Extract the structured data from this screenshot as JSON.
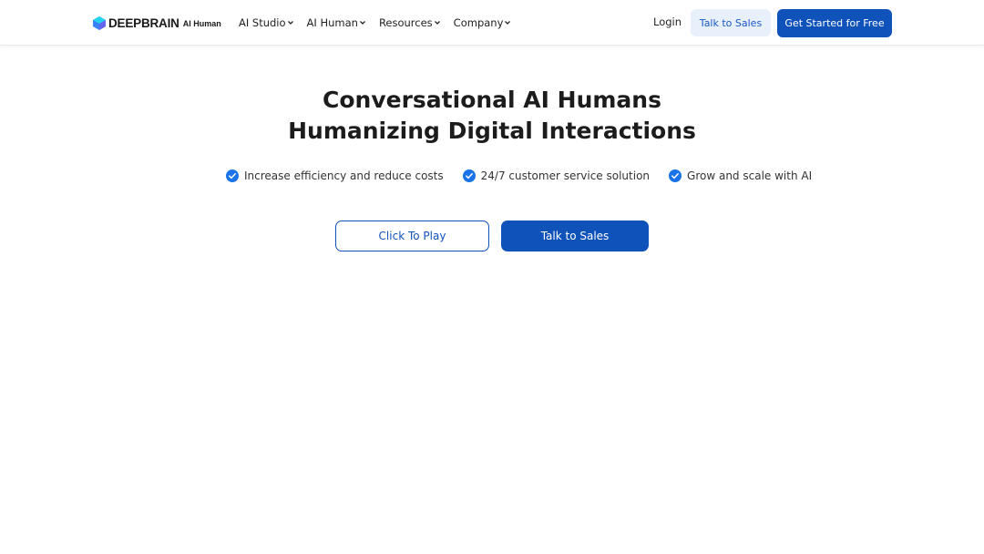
{
  "brand": {
    "name": "DEEPBRAIN",
    "sub": "AI Human"
  },
  "nav": {
    "items": [
      {
        "label": "AI Studio"
      },
      {
        "label": "AI Human"
      },
      {
        "label": "Resources"
      },
      {
        "label": "Company"
      }
    ],
    "login": "Login",
    "talk_to_sales": "Talk to Sales",
    "get_started": "Get Started for Free"
  },
  "hero": {
    "title_line1": "Conversational AI Humans",
    "title_line2": "Humanizing Digital Interactions",
    "features": [
      "Increase efficiency and reduce costs",
      "24/7 customer service solution",
      "Grow and scale with AI"
    ],
    "play_button": "Click To Play",
    "sales_button": "Talk to Sales"
  },
  "colors": {
    "primary": "#0f52ba",
    "primary_light": "#e8f1fb",
    "check": "#1a73e8"
  }
}
